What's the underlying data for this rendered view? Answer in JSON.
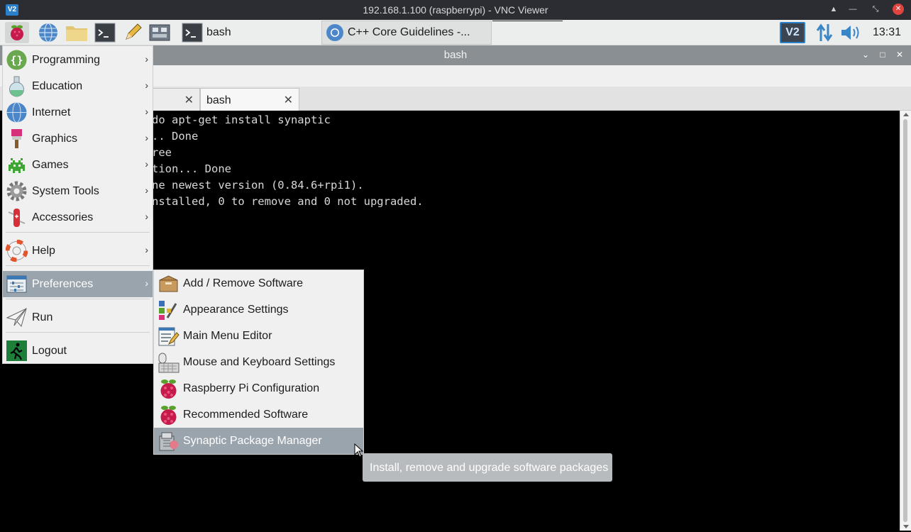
{
  "vnc": {
    "title": "192.168.1.100 (raspberrypi) - VNC Viewer",
    "logo": "V2",
    "controls": [
      "restore-up-icon",
      "minimize-icon",
      "shrink-icon",
      "close-icon"
    ]
  },
  "panel": {
    "launchers": [
      "raspberry-menu-icon",
      "web-browser-icon",
      "file-manager-icon",
      "terminal-icon",
      "text-editor-icon",
      "debug-tool-icon"
    ],
    "tasks": [
      {
        "label": "bash",
        "icon": "terminal-icon"
      },
      {
        "label": "C++ Core Guidelines -...",
        "icon": "chromium-icon"
      }
    ],
    "tray": {
      "vnc_icon": "V2",
      "network_icon": "network-updown-icon",
      "volume_icon": "volume-icon",
      "clock": "13:31"
    }
  },
  "terminal": {
    "title": "bash",
    "tabs": [
      {
        "label": "",
        "close": "✕"
      },
      {
        "label": "bash",
        "close": "✕"
      }
    ],
    "lines": [
      "do apt-get install synaptic",
      ".. Done",
      "ree",
      "tion... Done",
      "ne newest version (0.84.6+rpi1).",
      "nstalled, 0 to remove and 0 not upgraded."
    ]
  },
  "main_menu": {
    "items": [
      {
        "label": "Programming",
        "icon": "programming-braces-icon"
      },
      {
        "label": "Education",
        "icon": "flask-icon"
      },
      {
        "label": "Internet",
        "icon": "globe-icon"
      },
      {
        "label": "Graphics",
        "icon": "paintbrush-icon"
      },
      {
        "label": "Games",
        "icon": "space-invader-icon"
      },
      {
        "label": "System Tools",
        "icon": "gear-icon"
      },
      {
        "label": "Accessories",
        "icon": "swiss-knife-icon"
      },
      {
        "label": "Help",
        "icon": "lifebuoy-icon"
      },
      {
        "label": "Preferences",
        "icon": "preferences-sliders-icon"
      },
      {
        "label": "Run",
        "icon": "paper-plane-icon"
      },
      {
        "label": "Logout",
        "icon": "exit-running-man-icon"
      }
    ]
  },
  "sub_menu": {
    "items": [
      {
        "label": "Add / Remove Software",
        "icon": "package-box-icon"
      },
      {
        "label": "Appearance Settings",
        "icon": "appearance-palette-icon"
      },
      {
        "label": "Main Menu Editor",
        "icon": "menu-editor-icon"
      },
      {
        "label": "Mouse and Keyboard Settings",
        "icon": "mouse-keyboard-icon"
      },
      {
        "label": "Raspberry Pi Configuration",
        "icon": "raspberry-icon"
      },
      {
        "label": "Recommended Software",
        "icon": "raspberry-icon"
      },
      {
        "label": "Synaptic Package Manager",
        "icon": "synaptic-icon"
      }
    ]
  },
  "tooltip": {
    "text": "Install, remove and upgrade software packages"
  },
  "colors": {
    "highlight": "#9aa4ad",
    "panel": "#eceded",
    "vnc_bar": "#2b2d33",
    "raspberry": "#c51a4a",
    "leaf": "#5aa02c"
  }
}
